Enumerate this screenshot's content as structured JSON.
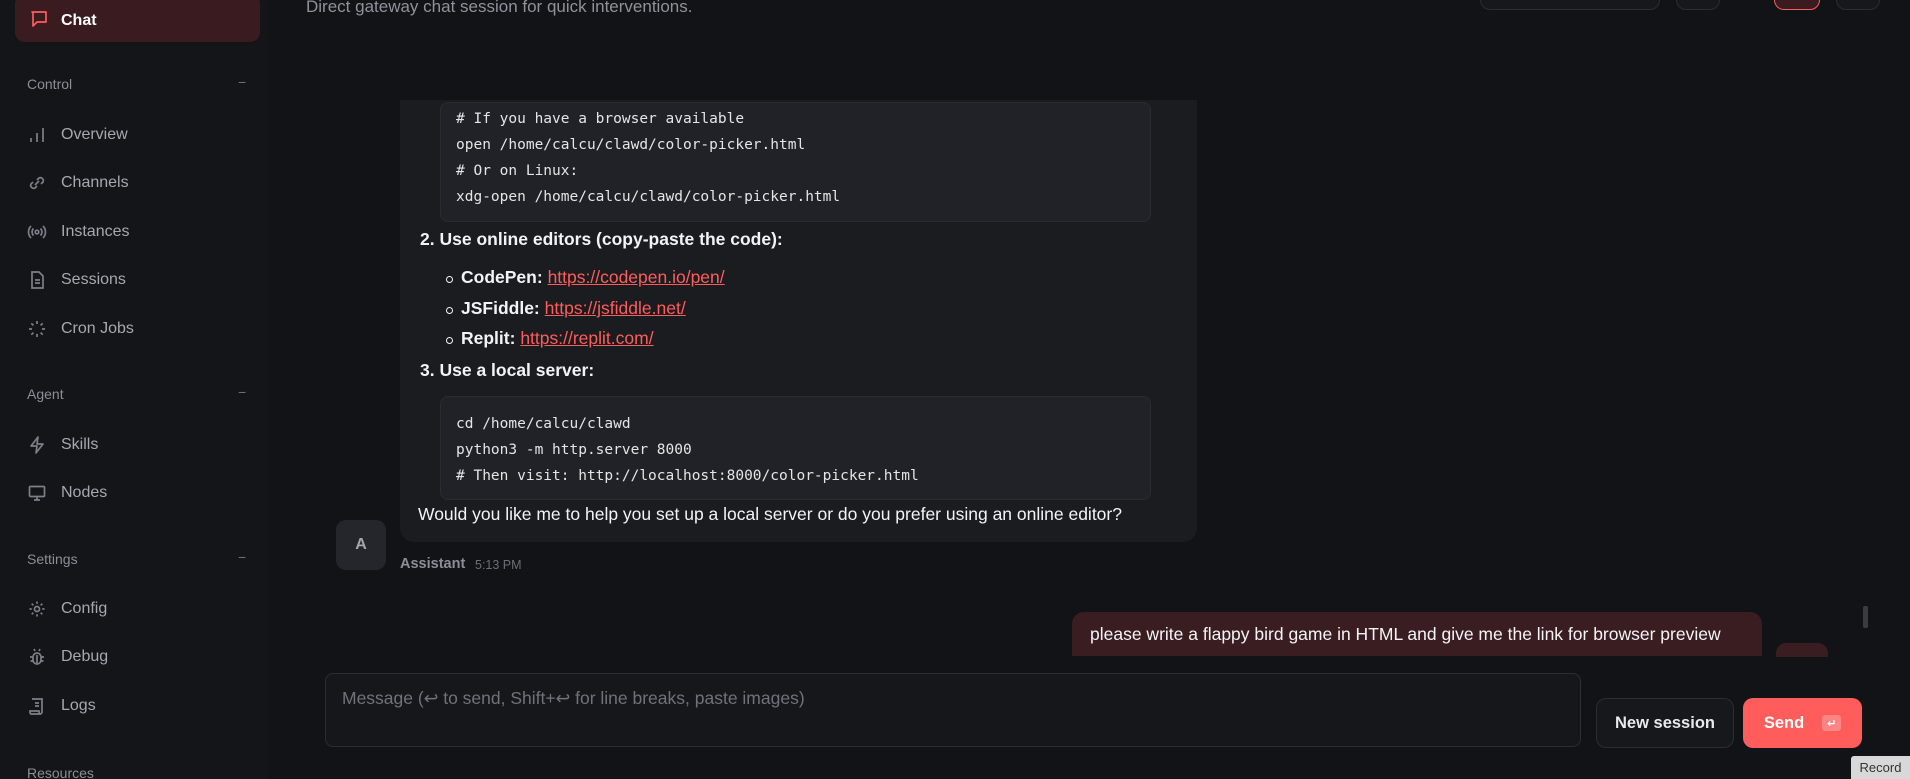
{
  "sidebar": {
    "active_item": {
      "label": "Chat",
      "icon": "chat-bubble-icon"
    },
    "sections": [
      {
        "title": "Control",
        "collapse": "−"
      },
      {
        "title": "Agent",
        "collapse": "−"
      },
      {
        "title": "Settings",
        "collapse": "−"
      },
      {
        "title": "Resources"
      }
    ],
    "control_items": [
      {
        "label": "Overview",
        "icon": "bar-chart-icon"
      },
      {
        "label": "Channels",
        "icon": "link-icon"
      },
      {
        "label": "Instances",
        "icon": "radio-icon"
      },
      {
        "label": "Sessions",
        "icon": "document-icon"
      },
      {
        "label": "Cron Jobs",
        "icon": "loader-icon"
      }
    ],
    "agent_items": [
      {
        "label": "Skills",
        "icon": "lightning-icon"
      },
      {
        "label": "Nodes",
        "icon": "monitor-icon"
      }
    ],
    "settings_items": [
      {
        "label": "Config",
        "icon": "gear-icon"
      },
      {
        "label": "Debug",
        "icon": "bug-icon"
      },
      {
        "label": "Logs",
        "icon": "scroll-icon"
      }
    ]
  },
  "header": {
    "subtitle": "Direct gateway chat session for quick interventions."
  },
  "assistant_message": {
    "code_block_1": [
      "# If you have a browser available",
      "open /home/calcu/clawd/color-picker.html",
      "# Or on Linux:",
      "xdg-open /home/calcu/clawd/color-picker.html"
    ],
    "step2": {
      "number": "2.",
      "text": "Use online editors (copy-paste the code):"
    },
    "editors": [
      {
        "name": "CodePen:",
        "url": "https://codepen.io/pen/"
      },
      {
        "name": "JSFiddle:",
        "url": "https://jsfiddle.net/"
      },
      {
        "name": "Replit:",
        "url": "https://replit.com/"
      }
    ],
    "step3": {
      "number": "3.",
      "text": "Use a local server:"
    },
    "code_block_2": [
      "cd /home/calcu/clawd",
      "python3 -m http.server 8000",
      "# Then visit: http://localhost:8000/color-picker.html"
    ],
    "closing": "Would you like me to help you set up a local server or do you prefer using an online editor?",
    "avatar": "A",
    "sender": "Assistant",
    "time": "5:13 PM"
  },
  "user_message": {
    "text": "please write a flappy bird game in HTML and give me the link for browser preview"
  },
  "composer": {
    "placeholder": "Message (↩ to send, Shift+↩ for line breaks, paste images)",
    "new_session_label": "New session",
    "send_label": "Send",
    "send_key": "↵"
  },
  "overlay": {
    "record_label": "Record"
  },
  "colors": {
    "accent": "#ff5c5c",
    "background": "#121316",
    "bubble_user": "#3a1d21"
  }
}
